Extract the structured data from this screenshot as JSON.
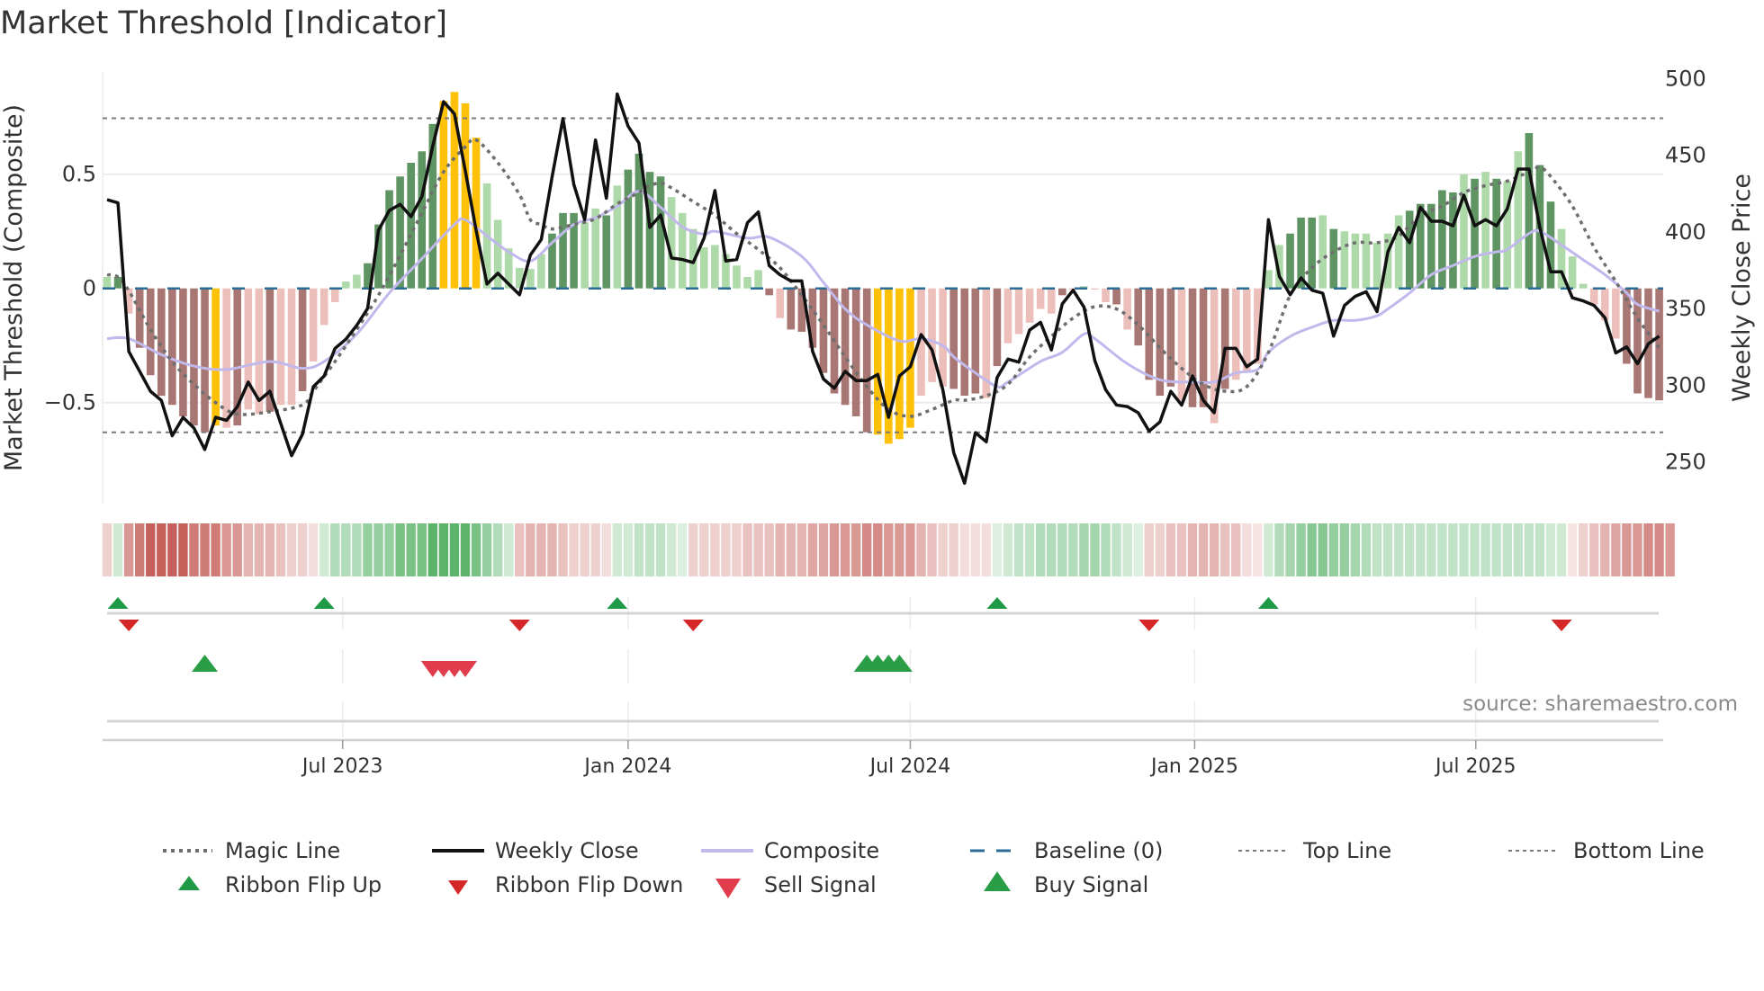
{
  "title": "Market Threshold [Indicator]",
  "source": "source: sharemaestro.com",
  "colors": {
    "bar_dark_green": "#5f9463",
    "bar_light_green": "#aed9a9",
    "bar_dark_red": "#a87774",
    "bar_light_red": "#ecbfbb",
    "bar_signal": "#ffc107",
    "ribbon_green": "#5cb46b",
    "ribbon_red": "#c5605a",
    "weekly_close": "#111111",
    "composite": "#c1b8ec",
    "magic": "#6e6e6e",
    "baseline": "#2b6c96",
    "threshold_lines": "#7a7a7a",
    "flip_up": "#1e9a46",
    "flip_down": "#d62728",
    "buy": "#2a9d47",
    "sell": "#e03c4b"
  },
  "chart_data": {
    "type": "bar+line",
    "title": "Market Threshold [Indicator]",
    "ylabel_left": "Market Threshold (Composite)",
    "ylabel_right": "Weekly Close Price",
    "x_unit": "weeks from start (~late Jan 2023), weekly",
    "ylim_left": [
      -0.937,
      0.945
    ],
    "ylim_right": [
      222,
      505
    ],
    "yticks_left": [
      {
        "v": 0.5,
        "label": "0.5"
      },
      {
        "v": 0,
        "label": "0"
      },
      {
        "v": -0.5,
        "label": "−0.5"
      }
    ],
    "yticks_right": [
      {
        "v": 500,
        "label": "500"
      },
      {
        "v": 450,
        "label": "450"
      },
      {
        "v": 400,
        "label": "400"
      },
      {
        "v": 350,
        "label": "350"
      },
      {
        "v": 300,
        "label": "300"
      },
      {
        "v": 250,
        "label": "250"
      }
    ],
    "xticks": [
      {
        "week": 21.7,
        "label": "Jul 2023"
      },
      {
        "week": 48.0,
        "label": "Jan 2024"
      },
      {
        "week": 74.0,
        "label": "Jul 2024"
      },
      {
        "week": 100.2,
        "label": "Jan 2025"
      },
      {
        "week": 126.1,
        "label": "Jul 2025"
      }
    ],
    "top_line": 0.745,
    "bottom_line": -0.63,
    "baseline": 0,
    "composite_bars": [
      0.05,
      0.05,
      -0.11,
      -0.26,
      -0.38,
      -0.47,
      -0.51,
      -0.56,
      -0.6,
      -0.63,
      -0.6,
      -0.61,
      -0.6,
      -0.53,
      -0.55,
      -0.54,
      -0.51,
      -0.51,
      -0.45,
      -0.32,
      -0.16,
      -0.06,
      0.03,
      0.06,
      0.11,
      0.28,
      0.43,
      0.49,
      0.55,
      0.6,
      0.72,
      0.82,
      0.86,
      0.81,
      0.66,
      0.46,
      0.3,
      0.175,
      0.09,
      0.085,
      0.15,
      0.24,
      0.33,
      0.33,
      0.29,
      0.35,
      0.32,
      0.45,
      0.52,
      0.59,
      0.51,
      0.49,
      0.4,
      0.33,
      0.26,
      0.18,
      0.19,
      0.15,
      0.1,
      0.05,
      0.08,
      -0.03,
      -0.13,
      -0.18,
      -0.19,
      -0.26,
      -0.37,
      -0.46,
      -0.51,
      -0.56,
      -0.63,
      -0.64,
      -0.68,
      -0.66,
      -0.61,
      -0.47,
      -0.41,
      -0.43,
      -0.44,
      -0.47,
      -0.46,
      -0.48,
      -0.34,
      -0.24,
      -0.2,
      -0.15,
      -0.09,
      -0.11,
      -0.03,
      -0.005,
      0.01,
      -0.005,
      -0.06,
      -0.07,
      -0.18,
      -0.25,
      -0.4,
      -0.47,
      -0.43,
      -0.49,
      -0.52,
      -0.52,
      -0.59,
      -0.44,
      -0.4,
      -0.36,
      -0.33,
      0.08,
      0.19,
      0.24,
      0.31,
      0.31,
      0.32,
      0.26,
      0.25,
      0.24,
      0.24,
      0.2,
      0.24,
      0.32,
      0.34,
      0.37,
      0.37,
      0.43,
      0.42,
      0.5,
      0.48,
      0.51,
      0.48,
      0.47,
      0.6,
      0.68,
      0.54,
      0.38,
      0.26,
      0.14,
      0.02,
      -0.07,
      -0.14,
      -0.22,
      -0.33,
      -0.46,
      -0.48,
      -0.49
    ],
    "bar_styles": "ldldddddddyldlldlldllllldddddddyyyylllllldddlldlddddllllllllldlddddddddyyyyllldddldllllldlllldlddddlddldllllldddldlllllldddddldldlldddlllllldddddd",
    "weekly_close": [
      421,
      419,
      322,
      309,
      296,
      290,
      267,
      279,
      272,
      258,
      279,
      277,
      286,
      302,
      290,
      296,
      275,
      254,
      268,
      299,
      306,
      324,
      330,
      339,
      350,
      401,
      414,
      418,
      410,
      423,
      456,
      485,
      477,
      440,
      401,
      366,
      373,
      366,
      359,
      385,
      395,
      436,
      474,
      431,
      408,
      460,
      422,
      490,
      469,
      458,
      403,
      411,
      383,
      382,
      380,
      396,
      427,
      381,
      382,
      406,
      413,
      378,
      372,
      368,
      368,
      322,
      304,
      298,
      309,
      303,
      303,
      307,
      279,
      306,
      312,
      333,
      323,
      297,
      256,
      236,
      269,
      263,
      305,
      317,
      315,
      336,
      341,
      323,
      353,
      362,
      351,
      316,
      297,
      287,
      286,
      282,
      270,
      276,
      296,
      287,
      306,
      290,
      282,
      324,
      324,
      312,
      317,
      408,
      371,
      359,
      370,
      362,
      360,
      332,
      352,
      358,
      361,
      348,
      387,
      403,
      393,
      416,
      407,
      407,
      404,
      424,
      404,
      408,
      404,
      415,
      441,
      441,
      403,
      374,
      374,
      357,
      355,
      352,
      344,
      321,
      325,
      314,
      327,
      332
    ],
    "composite_line": [
      [
        0,
        -0.22
      ],
      [
        2,
        -0.22
      ],
      [
        5,
        -0.29
      ],
      [
        8,
        -0.34
      ],
      [
        11,
        -0.355
      ],
      [
        15,
        -0.32
      ],
      [
        18,
        -0.35
      ],
      [
        20,
        -0.32
      ],
      [
        23,
        -0.2
      ],
      [
        26,
        -0.02
      ],
      [
        29,
        0.13
      ],
      [
        32,
        0.28
      ],
      [
        33,
        0.3
      ],
      [
        35,
        0.23
      ],
      [
        37,
        0.16
      ],
      [
        39,
        0.12
      ],
      [
        41,
        0.2
      ],
      [
        43,
        0.28
      ],
      [
        45,
        0.31
      ],
      [
        47,
        0.36
      ],
      [
        49,
        0.425
      ],
      [
        51,
        0.355
      ],
      [
        53,
        0.27
      ],
      [
        55,
        0.237
      ],
      [
        56,
        0.25
      ],
      [
        59,
        0.22
      ],
      [
        61,
        0.224
      ],
      [
        64,
        0.14
      ],
      [
        66,
        0.026
      ],
      [
        68,
        -0.09
      ],
      [
        70,
        -0.16
      ],
      [
        73,
        -0.23
      ],
      [
        75,
        -0.22
      ],
      [
        77,
        -0.25
      ],
      [
        78,
        -0.3
      ],
      [
        80,
        -0.37
      ],
      [
        82,
        -0.43
      ],
      [
        83,
        -0.41
      ],
      [
        86,
        -0.32
      ],
      [
        88,
        -0.28
      ],
      [
        90,
        -0.2
      ],
      [
        91,
        -0.22
      ],
      [
        94,
        -0.33
      ],
      [
        97,
        -0.4
      ],
      [
        100,
        -0.41
      ],
      [
        102,
        -0.41
      ],
      [
        104,
        -0.37
      ],
      [
        106,
        -0.355
      ],
      [
        107,
        -0.28
      ],
      [
        109,
        -0.21
      ],
      [
        111,
        -0.17
      ],
      [
        113,
        -0.14
      ],
      [
        115,
        -0.14
      ],
      [
        117,
        -0.12
      ],
      [
        118,
        -0.09
      ],
      [
        120,
        -0.02
      ],
      [
        122,
        0.06
      ],
      [
        124,
        0.1
      ],
      [
        126,
        0.14
      ],
      [
        128,
        0.16
      ],
      [
        129,
        0.17
      ],
      [
        131,
        0.24
      ],
      [
        132,
        0.25
      ],
      [
        134,
        0.19
      ],
      [
        136,
        0.125
      ],
      [
        138,
        0.06
      ],
      [
        140,
        -0.02
      ],
      [
        141,
        -0.07
      ],
      [
        143,
        -0.1
      ]
    ],
    "magic_line": [
      [
        0,
        0.06
      ],
      [
        1,
        0.05
      ],
      [
        2,
        -0.01
      ],
      [
        4,
        -0.18
      ],
      [
        6,
        -0.32
      ],
      [
        8,
        -0.42
      ],
      [
        10,
        -0.5
      ],
      [
        12,
        -0.55
      ],
      [
        15,
        -0.54
      ],
      [
        18,
        -0.51
      ],
      [
        19,
        -0.45
      ],
      [
        21,
        -0.32
      ],
      [
        23,
        -0.18
      ],
      [
        25,
        -0.03
      ],
      [
        27,
        0.145
      ],
      [
        29,
        0.33
      ],
      [
        31,
        0.51
      ],
      [
        33,
        0.62
      ],
      [
        34,
        0.65
      ],
      [
        36,
        0.55
      ],
      [
        38,
        0.41
      ],
      [
        39,
        0.3
      ],
      [
        40,
        0.28
      ],
      [
        41,
        0.26
      ],
      [
        43,
        0.28
      ],
      [
        45,
        0.305
      ],
      [
        47,
        0.37
      ],
      [
        49,
        0.42
      ],
      [
        50,
        0.45
      ],
      [
        51,
        0.46
      ],
      [
        52,
        0.44
      ],
      [
        54,
        0.38
      ],
      [
        56,
        0.32
      ],
      [
        58,
        0.24
      ],
      [
        60,
        0.17
      ],
      [
        62,
        0.09
      ],
      [
        64,
        -0.03
      ],
      [
        66,
        -0.16
      ],
      [
        68,
        -0.3
      ],
      [
        70,
        -0.43
      ],
      [
        72,
        -0.53
      ],
      [
        74,
        -0.56
      ],
      [
        76,
        -0.53
      ],
      [
        78,
        -0.49
      ],
      [
        79,
        -0.49
      ],
      [
        81,
        -0.47
      ],
      [
        83,
        -0.42
      ],
      [
        85,
        -0.3
      ],
      [
        87,
        -0.21
      ],
      [
        89,
        -0.13
      ],
      [
        91,
        -0.08
      ],
      [
        93,
        -0.09
      ],
      [
        95,
        -0.16
      ],
      [
        97,
        -0.26
      ],
      [
        99,
        -0.35
      ],
      [
        101,
        -0.42
      ],
      [
        103,
        -0.45
      ],
      [
        105,
        -0.43
      ],
      [
        107,
        -0.28
      ],
      [
        109,
        -0.03
      ],
      [
        111,
        0.09
      ],
      [
        113,
        0.16
      ],
      [
        115,
        0.2
      ],
      [
        117,
        0.2
      ],
      [
        119,
        0.23
      ],
      [
        121,
        0.32
      ],
      [
        123,
        0.36
      ],
      [
        125,
        0.42
      ],
      [
        127,
        0.45
      ],
      [
        129,
        0.47
      ],
      [
        131,
        0.51
      ],
      [
        132,
        0.53
      ],
      [
        133,
        0.49
      ],
      [
        135,
        0.36
      ],
      [
        137,
        0.18
      ],
      [
        139,
        0.03
      ],
      [
        141,
        -0.13
      ],
      [
        143,
        -0.26
      ]
    ],
    "ribbon_strength": [
      -0.2,
      0.2,
      -0.6,
      -0.8,
      -1,
      -1,
      -1,
      -1,
      -0.8,
      -0.8,
      -0.8,
      -0.6,
      -0.6,
      -0.4,
      -0.4,
      -0.4,
      -0.3,
      -0.2,
      -0.2,
      -0.1,
      0.2,
      0.4,
      0.4,
      0.4,
      0.6,
      0.6,
      0.6,
      0.8,
      0.8,
      0.8,
      1,
      1,
      1,
      1,
      0.8,
      0.6,
      0.4,
      0.2,
      -0.3,
      -0.4,
      -0.4,
      -0.4,
      -0.3,
      -0.2,
      -0.2,
      -0.2,
      -0.1,
      0.2,
      0.2,
      0.3,
      0.3,
      0.3,
      0.2,
      0.1,
      -0.2,
      -0.2,
      -0.2,
      -0.2,
      -0.2,
      -0.3,
      -0.3,
      -0.3,
      -0.4,
      -0.4,
      -0.4,
      -0.5,
      -0.5,
      -0.6,
      -0.6,
      -0.6,
      -0.7,
      -0.7,
      -0.6,
      -0.6,
      -0.6,
      -0.4,
      -0.3,
      -0.2,
      -0.2,
      -0.1,
      -0.1,
      -0.1,
      0.1,
      0.2,
      0.3,
      0.3,
      0.4,
      0.4,
      0.4,
      0.4,
      0.5,
      0.5,
      0.4,
      0.3,
      0.2,
      0.1,
      -0.2,
      -0.2,
      -0.3,
      -0.3,
      -0.4,
      -0.4,
      -0.4,
      -0.3,
      -0.3,
      -0.1,
      -0.06,
      0.2,
      0.4,
      0.5,
      0.6,
      0.7,
      0.7,
      0.6,
      0.6,
      0.5,
      0.4,
      0.3,
      0.3,
      0.3,
      0.3,
      0.3,
      0.3,
      0.3,
      0.3,
      0.3,
      0.3,
      0.3,
      0.3,
      0.3,
      0.3,
      0.3,
      0.3,
      0.2,
      0.2,
      -0.06,
      -0.2,
      -0.3,
      -0.4,
      -0.5,
      -0.6,
      -0.6,
      -0.7,
      -0.7,
      -0.6
    ],
    "ribbon_flip_up_weeks": [
      1,
      20,
      47,
      82,
      107
    ],
    "ribbon_flip_down_weeks": [
      2,
      38,
      54,
      96,
      134
    ],
    "buy_signal_weeks": [
      9,
      70,
      71,
      72,
      73
    ],
    "sell_signal_weeks": [
      30,
      31,
      32,
      33
    ],
    "legend": {
      "position": "bottom",
      "items": [
        {
          "label": "Magic Line",
          "kind": "dotted"
        },
        {
          "label": "Weekly Close",
          "kind": "line"
        },
        {
          "label": "Composite",
          "kind": "line-light"
        },
        {
          "label": "Baseline (0)",
          "kind": "dashed"
        },
        {
          "label": "Top Line",
          "kind": "dotted-thin"
        },
        {
          "label": "Bottom Line",
          "kind": "dotted-thin"
        },
        {
          "label": "Ribbon Flip Up",
          "kind": "tri-up-small"
        },
        {
          "label": "Ribbon Flip Down",
          "kind": "tri-down-small"
        },
        {
          "label": "Sell Signal",
          "kind": "tri-down"
        },
        {
          "label": "Buy Signal",
          "kind": "tri-up"
        }
      ]
    }
  }
}
